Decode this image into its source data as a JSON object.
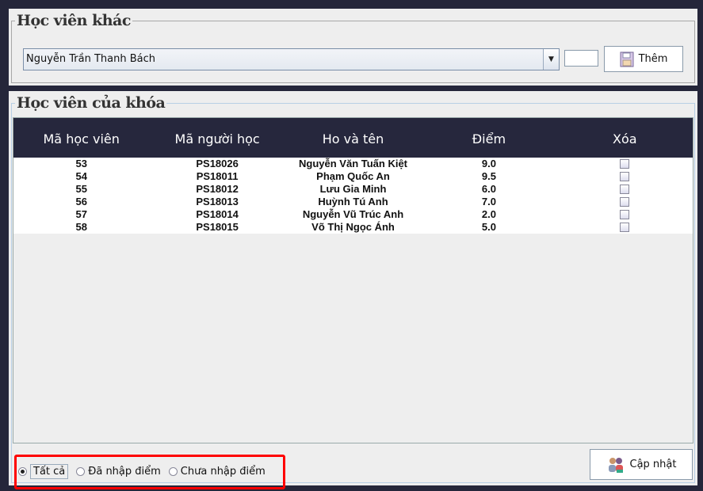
{
  "other_students": {
    "title": "Học viên khác",
    "combo_value": "Nguyễn Trần Thanh Bách",
    "score_value": "",
    "add_label": "Thêm"
  },
  "course_students": {
    "title": "Học viên của khóa",
    "columns": [
      "Mã học viên",
      "Mã người học",
      "Ho và tên",
      "Điểm",
      "Xóa"
    ],
    "rows": [
      {
        "id": "53",
        "code": "PS18026",
        "name": "Nguyễn Văn Tuấn Kiệt",
        "score": "9.0",
        "delete": false
      },
      {
        "id": "54",
        "code": "PS18011",
        "name": "Phạm Quốc An",
        "score": "9.5",
        "delete": false
      },
      {
        "id": "55",
        "code": "PS18012",
        "name": "Lưu Gia Minh",
        "score": "6.0",
        "delete": false
      },
      {
        "id": "56",
        "code": "PS18013",
        "name": "Huỳnh Tú Anh",
        "score": "7.0",
        "delete": false
      },
      {
        "id": "57",
        "code": "PS18014",
        "name": "Nguyễn Vũ Trúc Anh",
        "score": "2.0",
        "delete": false
      },
      {
        "id": "58",
        "code": "PS18015",
        "name": "Võ Thị Ngọc Ánh",
        "score": "5.0",
        "delete": false
      }
    ]
  },
  "filter": {
    "options": [
      "Tất cả",
      "Đã nhập điểm",
      "Chưa nhập điểm"
    ],
    "selected": 0
  },
  "update_label": "Cập nhật",
  "colors": {
    "background": "#25263a",
    "header": "#26273d",
    "highlight": "#ff0000"
  }
}
